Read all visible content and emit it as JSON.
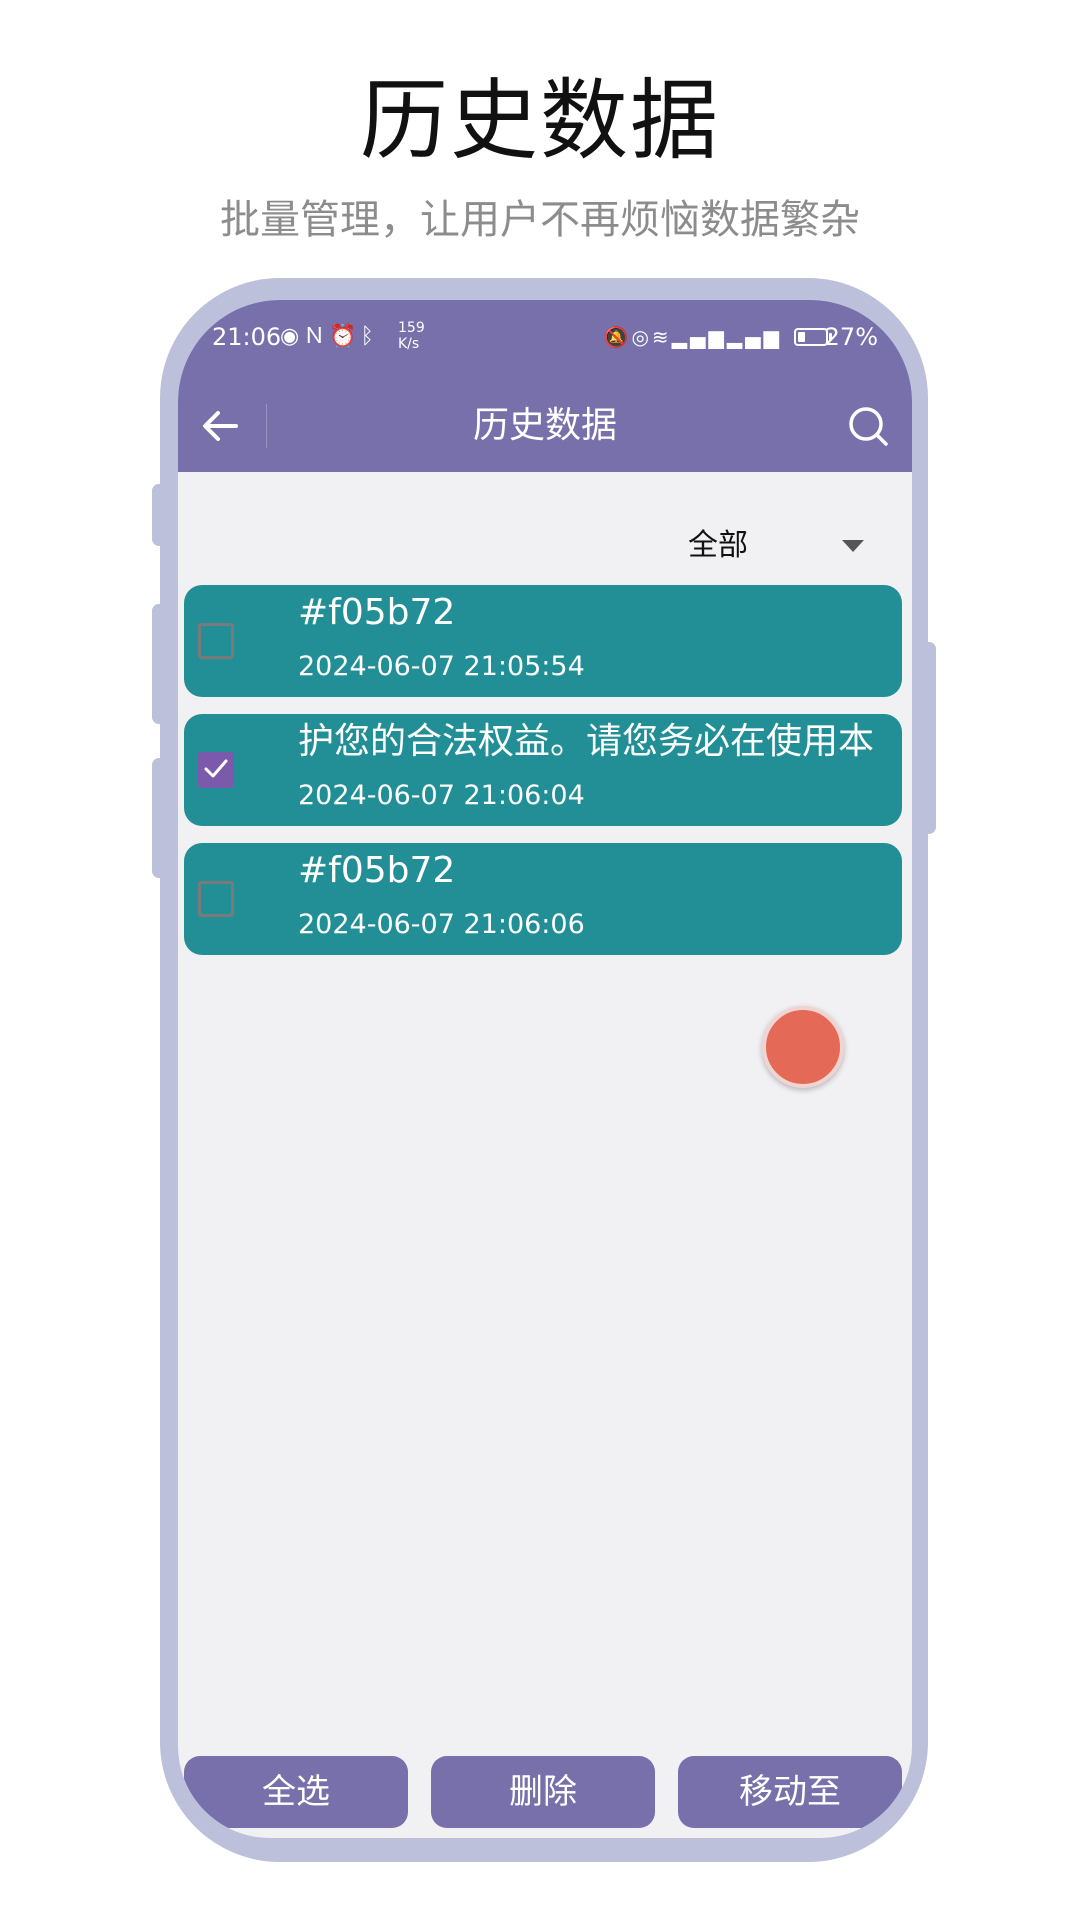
{
  "hero": {
    "title": "历史数据",
    "subtitle": "批量管理，让用户不再烦恼数据繁杂"
  },
  "status_bar": {
    "time": "21:06",
    "net_speed_value": "159",
    "net_speed_unit": "K/s",
    "battery_percent": "27%",
    "battery_level": 0.27
  },
  "app_bar": {
    "title": "历史数据"
  },
  "filter": {
    "selected": "全部"
  },
  "items": [
    {
      "title": "#f05b72",
      "time": "2024-06-07 21:05:54",
      "checked": false
    },
    {
      "title": "护您的合法权益。请您务必在使用本",
      "time": "2024-06-07 21:06:04",
      "checked": true
    },
    {
      "title": "#f05b72",
      "time": "2024-06-07 21:06:06",
      "checked": false
    }
  ],
  "actions": {
    "select_all": "全选",
    "delete": "删除",
    "move_to": "移动至"
  },
  "colors": {
    "primary": "#7870ab",
    "item_background": "#218f95",
    "checkbox_checked": "#7b5aab",
    "fab": "#e46957",
    "frame": "#bcc0db"
  }
}
